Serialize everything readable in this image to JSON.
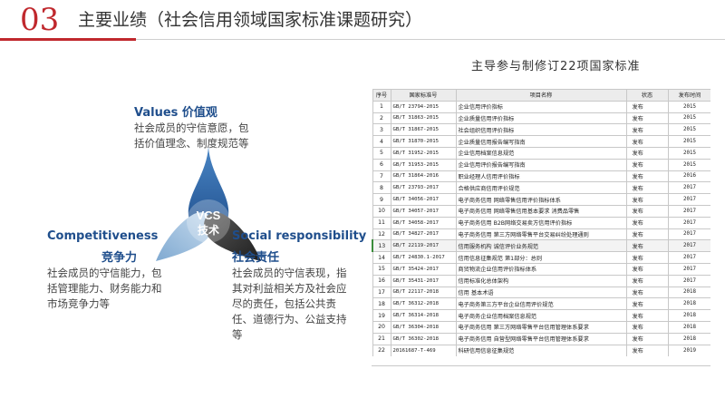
{
  "header": {
    "number": "03",
    "title": "主要业绩（社会信用领域国家标准课题研究）"
  },
  "vcs": {
    "center_top": "VCS",
    "center_bottom": "技术",
    "values": {
      "title": "Values  价值观",
      "text": "社会成员的守信意愿，包括价值理念、制度规范等"
    },
    "competitiveness": {
      "title": "Competitiveness",
      "sub": "竞争力",
      "text": "社会成员的守信能力，包括管理能力、财务能力和市场竞争力等"
    },
    "social": {
      "title": "Social responsibility",
      "sub": "社会责任",
      "text": "社会成员的守信表现，指其对利益相关方及社会应尽的责任，包括公共责任、道德行为、公益支持等"
    },
    "colors": {
      "top": "#3a6fa8",
      "left": "#9fbfdc",
      "right": "#3b3b3b"
    }
  },
  "standards": {
    "caption": "主导参与制修订22项国家标准",
    "headers": [
      "序号",
      "国家标准号",
      "项目名称",
      "状态",
      "发布时间"
    ],
    "rows": [
      [
        "1",
        "GB/T 23794-2015",
        "企业信用评价指标",
        "发布",
        "2015"
      ],
      [
        "2",
        "GB/T 31863-2015",
        "企业质量信用评价指标",
        "发布",
        "2015"
      ],
      [
        "3",
        "GB/T 31867-2015",
        "社会组织信用评价指标",
        "发布",
        "2015"
      ],
      [
        "4",
        "GB/T 31870-2015",
        "企业质量信用报告编写指南",
        "发布",
        "2015"
      ],
      [
        "5",
        "GB/T 31952-2015",
        "企业信用档案信息规范",
        "发布",
        "2015"
      ],
      [
        "6",
        "GB/T 31953-2015",
        "企业信用评价报告编写指南",
        "发布",
        "2015"
      ],
      [
        "7",
        "GB/T 31864-2016",
        "职业经理人信用评价指标",
        "发布",
        "2016"
      ],
      [
        "8",
        "GB/T 23793-2017",
        "合格供应商信用评价规范",
        "发布",
        "2017"
      ],
      [
        "9",
        "GB/T 34056-2017",
        "电子商务信用 网络零售信用评价指标体系",
        "发布",
        "2017"
      ],
      [
        "10",
        "GB/T 34057-2017",
        "电子商务信用 网络零售信用基本要求 消费品零售",
        "发布",
        "2017"
      ],
      [
        "11",
        "GB/T 34058-2017",
        "电子商务信用 B2B网络交易卖方信用评价指标",
        "发布",
        "2017"
      ],
      [
        "12",
        "GB/T 34827-2017",
        "电子商务信用 第三方网络零售平台交易纠纷处理通则",
        "发布",
        "2017"
      ],
      [
        "13",
        "GB/T 22119-2017",
        "信用服务机构 诚信评价业务规范",
        "发布",
        "2017"
      ],
      [
        "14",
        "GB/T 24830.1-2017",
        "信用信息征集规范 第1部分：总则",
        "发布",
        "2017"
      ],
      [
        "15",
        "GB/T 35424-2017",
        "商贸物流企业信用评价指标体系",
        "发布",
        "2017"
      ],
      [
        "16",
        "GB/T 35431-2017",
        "信用标准化总体架构",
        "发布",
        "2017"
      ],
      [
        "17",
        "GB/T 22117-2018",
        "信用 基本术语",
        "发布",
        "2018"
      ],
      [
        "18",
        "GB/T 36312-2018",
        "电子商务第三方平台企业信用评价规范",
        "发布",
        "2018"
      ],
      [
        "19",
        "GB/T 36314-2018",
        "电子商务企业信用档案信息规范",
        "发布",
        "2018"
      ],
      [
        "20",
        "GB/T 36304-2018",
        "电子商务信用 第三方网络零售平台信用管理体系要求",
        "发布",
        "2018"
      ],
      [
        "21",
        "GB/T 36302-2018",
        "电子商务信用 自营型网络零售平台信用管理体系要求",
        "发布",
        "2018"
      ],
      [
        "22",
        "20161687-T-469",
        "科研信用信息征集规范",
        "发布",
        "2019"
      ]
    ]
  }
}
